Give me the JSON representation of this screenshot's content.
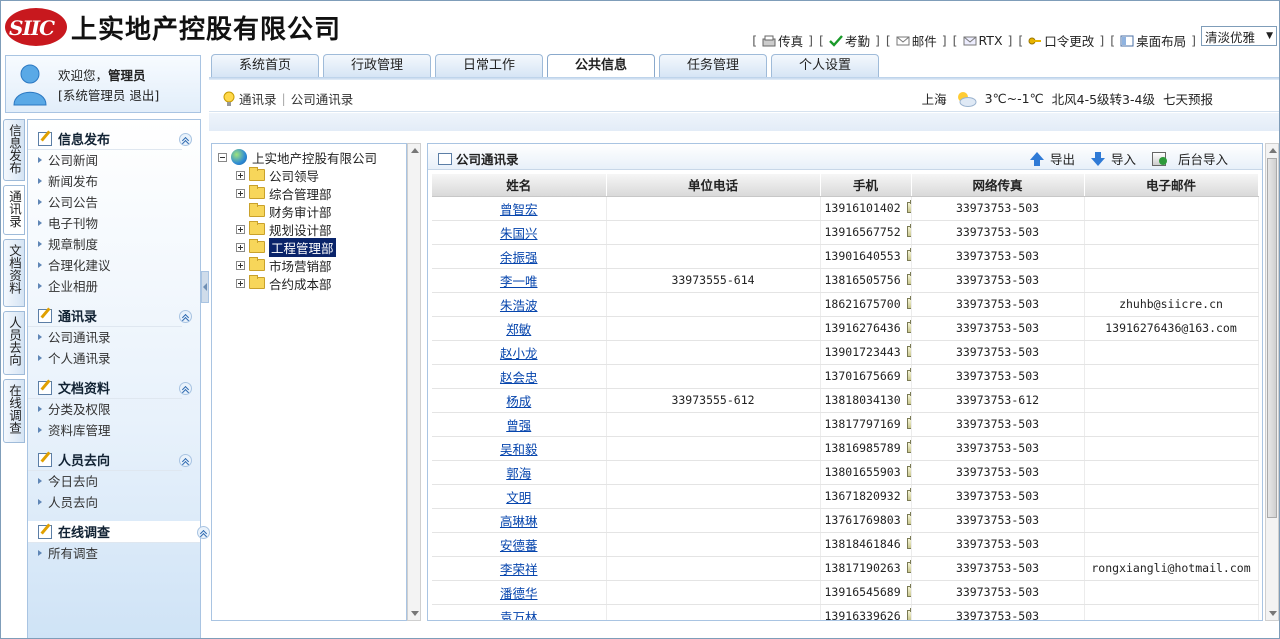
{
  "header": {
    "logo_mark": "SIIC",
    "company_name": "上实地产控股有限公司",
    "toolbar": [
      {
        "label": "传真",
        "icon": "fax-icon"
      },
      {
        "label": "考勤",
        "icon": "checkmark-icon"
      },
      {
        "label": "邮件",
        "icon": "mail-icon"
      },
      {
        "label": "RTX",
        "icon": "rtx-mail-icon"
      },
      {
        "label": "口令更改",
        "icon": "key-icon"
      },
      {
        "label": "桌面布局",
        "icon": "layout-icon"
      }
    ],
    "theme_select": {
      "value": "清淡优雅"
    }
  },
  "user": {
    "welcome": "欢迎您，",
    "name": "管理员",
    "role_link": "[系统管理员",
    "logout": "退出]"
  },
  "tabs": [
    {
      "label": "系统首页",
      "active": false
    },
    {
      "label": "行政管理",
      "active": false
    },
    {
      "label": "日常工作",
      "active": false
    },
    {
      "label": "公共信息",
      "active": true
    },
    {
      "label": "任务管理",
      "active": false
    },
    {
      "label": "个人设置",
      "active": false
    }
  ],
  "breadcrumb": {
    "root": "通讯录",
    "current": "公司通讯录"
  },
  "weather": {
    "city": "上海",
    "temp": "3℃~-1℃",
    "wind": "北风4-5级转3-4级",
    "forecast": "七天预报"
  },
  "vtabs": [
    "信息发布",
    "通讯录",
    "文档资料",
    "人员去向",
    "在线调查"
  ],
  "sidebar": [
    {
      "title": "信息发布",
      "items": [
        "公司新闻",
        "新闻发布",
        "公司公告",
        "电子刊物",
        "规章制度",
        "合理化建议",
        "企业相册"
      ]
    },
    {
      "title": "通讯录",
      "items": [
        "公司通讯录",
        "个人通讯录"
      ]
    },
    {
      "title": "文档资料",
      "items": [
        "分类及权限",
        "资料库管理"
      ]
    },
    {
      "title": "人员去向",
      "items": [
        "今日去向",
        "人员去向"
      ]
    },
    {
      "title": "在线调查",
      "items": [
        "所有调查"
      ]
    }
  ],
  "tree": {
    "root": "上实地产控股有限公司",
    "nodes": [
      {
        "label": "公司领导",
        "expandable": true,
        "selected": false
      },
      {
        "label": "综合管理部",
        "expandable": true,
        "selected": false
      },
      {
        "label": "财务审计部",
        "expandable": false,
        "selected": false
      },
      {
        "label": "规划设计部",
        "expandable": true,
        "selected": false
      },
      {
        "label": "工程管理部",
        "expandable": true,
        "selected": true
      },
      {
        "label": "市场营销部",
        "expandable": true,
        "selected": false
      },
      {
        "label": "合约成本部",
        "expandable": true,
        "selected": false
      }
    ]
  },
  "directory": {
    "title": "公司通讯录",
    "actions": {
      "export": "导出",
      "import": "导入",
      "backend_import": "后台导入"
    },
    "columns": [
      "姓名",
      "单位电话",
      "手机",
      "网络传真",
      "电子邮件"
    ],
    "rows": [
      {
        "name": "曾智宏",
        "office": "",
        "mobile": "13916101402",
        "fax": "33973753-503",
        "email": ""
      },
      {
        "name": "朱国兴",
        "office": "",
        "mobile": "13916567752",
        "fax": "33973753-503",
        "email": ""
      },
      {
        "name": "余振强",
        "office": "",
        "mobile": "13901640553",
        "fax": "33973753-503",
        "email": ""
      },
      {
        "name": "李一唯",
        "office": "33973555-614",
        "mobile": "13816505756",
        "fax": "33973753-503",
        "email": ""
      },
      {
        "name": "朱浩波",
        "office": "",
        "mobile": "18621675700",
        "fax": "33973753-503",
        "email": "zhuhb@siicre.cn"
      },
      {
        "name": "郑敏",
        "office": "",
        "mobile": "13916276436",
        "fax": "33973753-503",
        "email": "13916276436@163.com"
      },
      {
        "name": "赵小龙",
        "office": "",
        "mobile": "13901723443",
        "fax": "33973753-503",
        "email": ""
      },
      {
        "name": "赵会忠",
        "office": "",
        "mobile": "13701675669",
        "fax": "33973753-503",
        "email": ""
      },
      {
        "name": "杨成",
        "office": "33973555-612",
        "mobile": "13818034130",
        "fax": "33973753-612",
        "email": ""
      },
      {
        "name": "曾强",
        "office": "",
        "mobile": "13817797169",
        "fax": "33973753-503",
        "email": ""
      },
      {
        "name": "吴和毅",
        "office": "",
        "mobile": "13816985789",
        "fax": "33973753-503",
        "email": ""
      },
      {
        "name": "郭海",
        "office": "",
        "mobile": "13801655903",
        "fax": "33973753-503",
        "email": ""
      },
      {
        "name": "文明",
        "office": "",
        "mobile": "13671820932",
        "fax": "33973753-503",
        "email": ""
      },
      {
        "name": "高琳琳",
        "office": "",
        "mobile": "13761769803",
        "fax": "33973753-503",
        "email": ""
      },
      {
        "name": "安德蕃",
        "office": "",
        "mobile": "13818461846",
        "fax": "33973753-503",
        "email": ""
      },
      {
        "name": "李荣祥",
        "office": "",
        "mobile": "13817190263",
        "fax": "33973753-503",
        "email": "rongxiangli@hotmail.com"
      },
      {
        "name": "潘德华",
        "office": "",
        "mobile": "13916545689",
        "fax": "33973753-503",
        "email": ""
      },
      {
        "name": "袁万林",
        "office": "",
        "mobile": "13916339626",
        "fax": "33973753-503",
        "email": ""
      }
    ]
  },
  "colors": {
    "accent_blue": "#2f7ad6",
    "logo_red": "#c8181e",
    "link": "#0645ad",
    "selection": "#0a246a"
  }
}
